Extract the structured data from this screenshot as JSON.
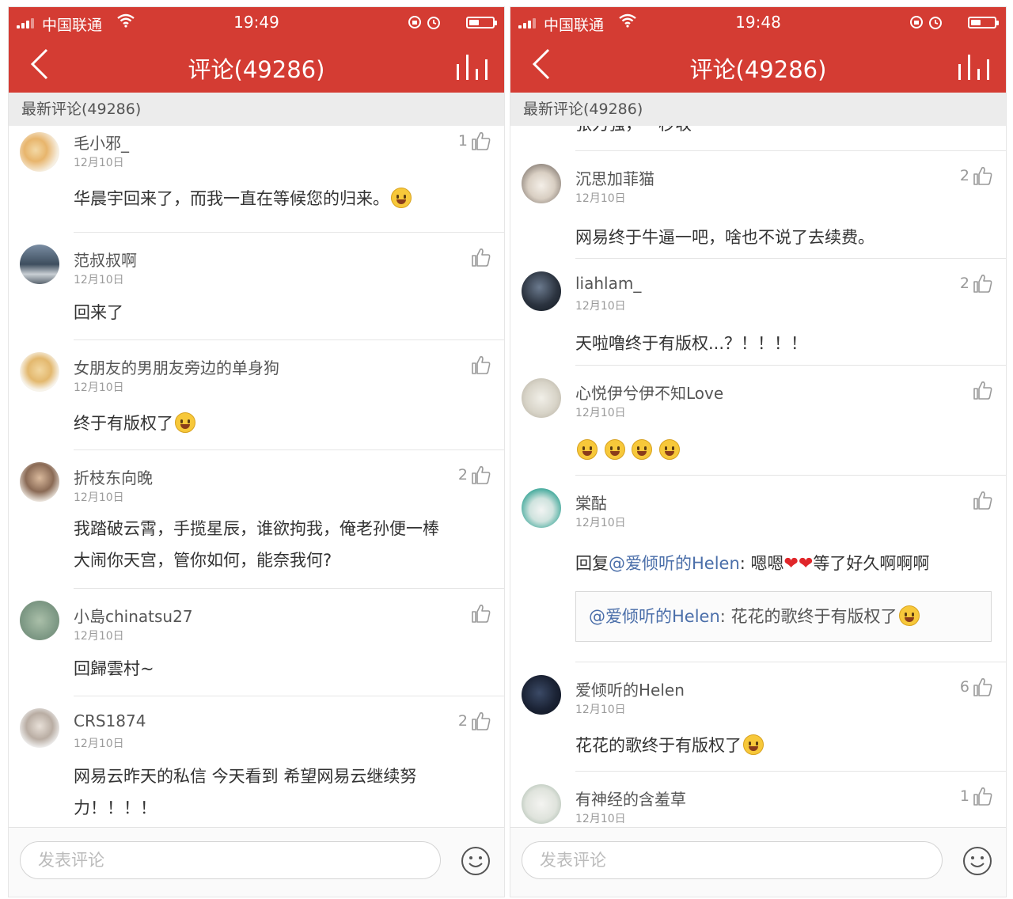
{
  "colors": {
    "accent": "#d43c33"
  },
  "screens": [
    {
      "status": {
        "carrier": "中国联通",
        "time": "19:49"
      },
      "nav": {
        "title": "评论(49286)",
        "back_icon": "chevron-left-icon",
        "chart_icon": "chart-bars-icon"
      },
      "section_header": "最新评论(49286)",
      "comments": [
        {
          "user": "毛小邪_",
          "date": "12月10日",
          "likes": "1",
          "text": "华晨宇回来了，而我一直在等候您的归来。"
        },
        {
          "user": "范叔叔啊",
          "date": "12月10日",
          "likes": "",
          "text": "回来了"
        },
        {
          "user": "女朋友的男朋友旁边的单身狗",
          "date": "12月10日",
          "likes": "",
          "text": "终于有版权了"
        },
        {
          "user": "折枝东向晚",
          "date": "12月10日",
          "likes": "2",
          "text": "我踏破云霄，手揽星辰，谁欲拘我，俺老孙便一棒",
          "text2": "大闹你天宫，管你如何，能奈我何?"
        },
        {
          "user": "小島chinatsu27",
          "date": "12月10日",
          "likes": "",
          "text": "回歸雲村~"
        },
        {
          "user": "CRS1874",
          "date": "12月10日",
          "likes": "2",
          "text": "网易云昨天的私信 今天看到 希望网易云继续努",
          "text2": "力！！！！"
        }
      ],
      "input_placeholder": "发表评论"
    },
    {
      "status": {
        "carrier": "中国联通",
        "time": "19:48"
      },
      "nav": {
        "title": "评论(49286)",
        "back_icon": "chevron-left-icon",
        "chart_icon": "chart-bars-icon"
      },
      "section_header": "最新评论(49286)",
      "partial_text": "张力强，一秒收",
      "comments": [
        {
          "user": "沉思加菲猫",
          "date": "12月10日",
          "likes": "2",
          "text": "网易终于牛逼一吧，啥也不说了去续费。"
        },
        {
          "user": "liahlam_",
          "date": "12月10日",
          "likes": "2",
          "text": "天啦噜终于有版权...？！！！！"
        },
        {
          "user": "心悦伊兮伊不知Love",
          "date": "12月10日",
          "likes": "",
          "text": ""
        },
        {
          "user": "棠酤",
          "date": "12月10日",
          "likes": "",
          "reply_prefix": "回复",
          "mention": "@爱倾听的Helen",
          "text": ": 嗯嗯",
          "text_after": "等了好久啊啊啊",
          "quote_mention": "@爱倾听的Helen",
          "quote_text": ": 花花的歌终于有版权了"
        },
        {
          "user": "爱倾听的Helen",
          "date": "12月10日",
          "likes": "6",
          "text": "花花的歌终于有版权了"
        },
        {
          "user": "有神经的含羞草",
          "date": "12月10日",
          "likes": "1",
          "text": ""
        }
      ],
      "input_placeholder": "发表评论"
    }
  ]
}
